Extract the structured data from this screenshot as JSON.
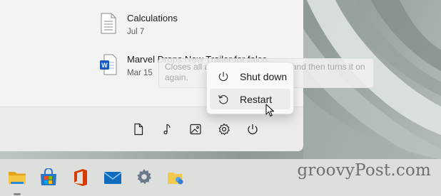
{
  "recommended": [
    {
      "title": "Calculations",
      "date": "Jul 7",
      "icon": "text-document-icon"
    },
    {
      "title": "Marvel Drops New Trailer for falco...",
      "date": "Mar 15",
      "icon": "word-document-icon"
    }
  ],
  "tooltip": {
    "text": "Closes all apps, turns off the PC, and then turns it on again."
  },
  "power_menu": {
    "items": [
      {
        "label": "Shut down",
        "icon": "power-icon"
      },
      {
        "label": "Restart",
        "icon": "restart-icon",
        "highlighted": true
      }
    ]
  },
  "footer_icons": [
    "documents-icon",
    "music-icon",
    "pictures-icon",
    "settings-icon",
    "power-icon"
  ],
  "taskbar": {
    "apps": [
      "file-explorer-icon",
      "microsoft-store-icon",
      "office-icon",
      "mail-icon",
      "settings-icon",
      "user-folder-icon"
    ]
  },
  "watermark": "groovyPost.com",
  "colors": {
    "panel": "#f3f3f3",
    "flyout": "#f9f9f9",
    "taskbar": "#dddfdd",
    "office_red": "#d83b01",
    "mail_blue": "#0f6cbd",
    "explorer_yellow": "#f2b705"
  }
}
